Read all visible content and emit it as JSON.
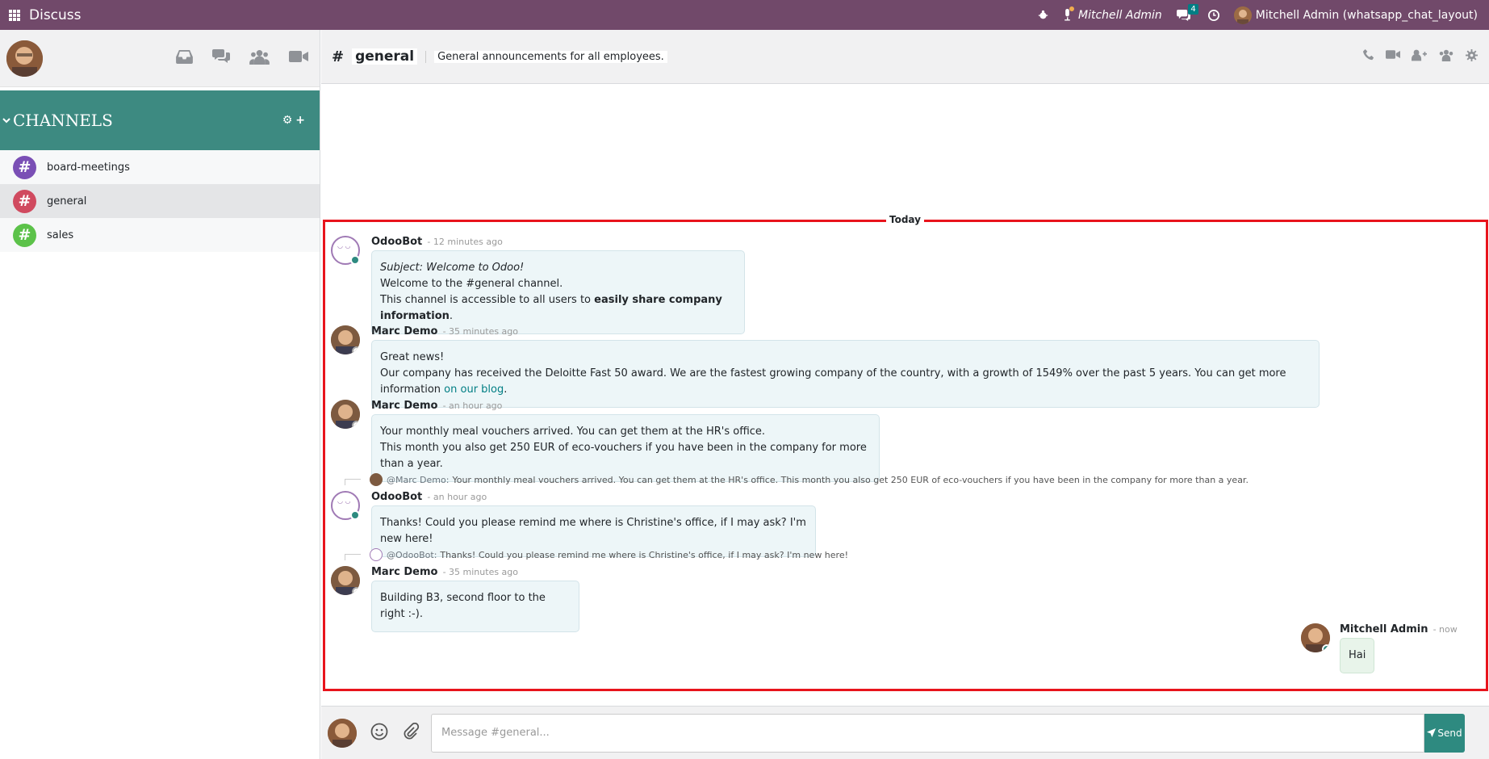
{
  "app": {
    "title": "Discuss"
  },
  "topbar": {
    "user_name": "Mitchell Admin",
    "messages_badge": "4",
    "user_chip": "Mitchell Admin (whatsapp_chat_layout)"
  },
  "sidebar": {
    "channels_title": "CHANNELS",
    "channels_actions": "⚙+",
    "channels": [
      {
        "label": "board-meetings",
        "color": "#7a4fb5",
        "active": false
      },
      {
        "label": "general",
        "color": "#d04a5f",
        "active": true
      },
      {
        "label": "sales",
        "color": "#5cc24a",
        "active": false
      }
    ]
  },
  "header": {
    "hash": "#",
    "channel": "general",
    "description": "General announcements for all employees."
  },
  "thread": {
    "date_separator": "Today",
    "messages": [
      {
        "author": "OdooBot",
        "time": "- 12 minutes ago",
        "lines": [
          "Subject: Welcome to Odoo!",
          "Welcome to the #general channel.",
          "This channel is accessible to all users to ",
          "easily share company information",
          "."
        ]
      },
      {
        "author": "Marc Demo",
        "time": "- 35 minutes ago",
        "lines": [
          "Great news!",
          "Our company has received the Deloitte Fast 50 award. We are the fastest growing company of the country, with a growth of 1549% over the past 5 years. You can get more information ",
          "on our blog",
          "."
        ]
      },
      {
        "author": "Marc Demo",
        "time": "- an hour ago",
        "lines": [
          "Your monthly meal vouchers arrived. You can get them at the HR's office.",
          "This month you also get 250 EUR of eco-vouchers if you have been in the company for more than a year."
        ]
      },
      {
        "reply_author": "@Marc Demo:",
        "reply_text": "Your monthly meal vouchers arrived. You can get them at the HR's office. This month you also get 250 EUR of eco-vouchers if you have been in the company for more than a year.",
        "author": "OdooBot",
        "time": "- an hour ago",
        "lines": [
          "Thanks! Could you please remind me where is Christine's office, if I may ask? I'm new here!"
        ]
      },
      {
        "reply_author": "@OdooBot:",
        "reply_text": "Thanks! Could you please remind me where is Christine's office, if I may ask? I'm new here!",
        "author": "Marc Demo",
        "time": "- 35 minutes ago",
        "lines": [
          "Building B3, second floor to the right :-)."
        ]
      },
      {
        "author": "Mitchell Admin",
        "time": "- now",
        "lines": [
          "Hai"
        ]
      }
    ]
  },
  "composer": {
    "placeholder": "Message #general...",
    "send_label": "Send"
  },
  "colors": {
    "topbar": "#71496a",
    "accent": "#2e8a80",
    "highlight_border": "#e8141c"
  }
}
